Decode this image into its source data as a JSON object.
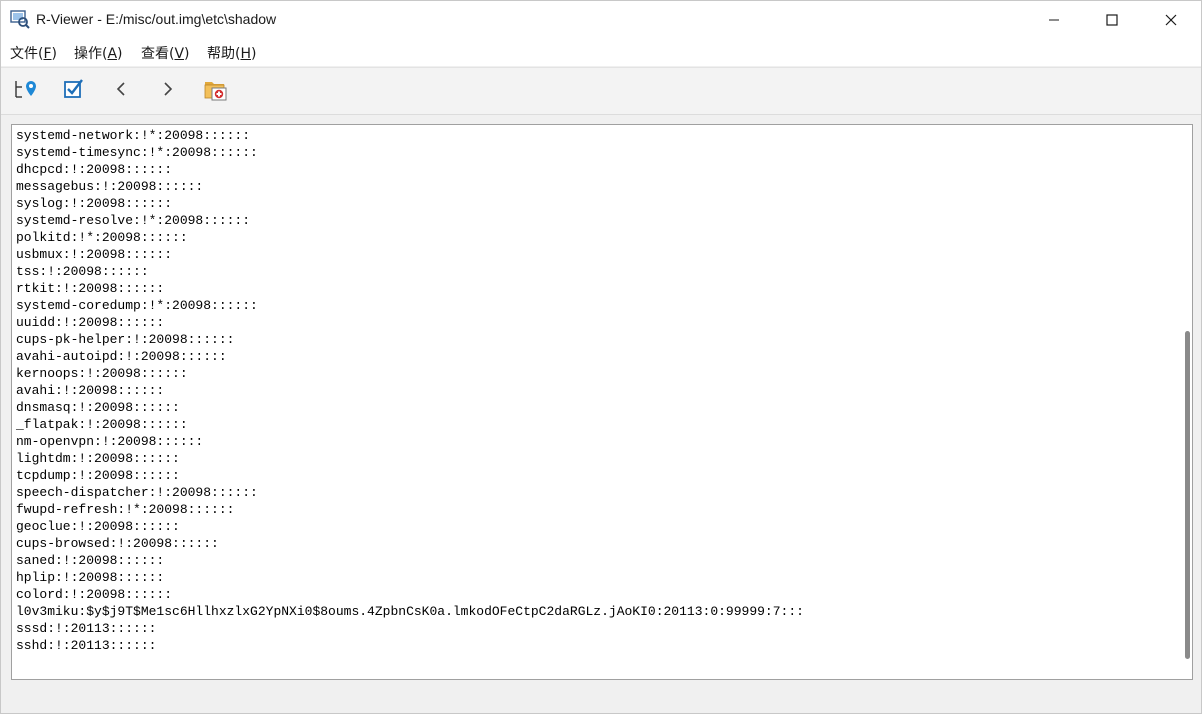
{
  "window": {
    "title": "R-Viewer - E:/misc/out.img\\etc\\shadow",
    "icons": [
      "app-icon",
      "minimize-icon",
      "maximize-icon",
      "close-icon"
    ]
  },
  "menu": {
    "items": [
      {
        "label": "文件",
        "hotkey": "F"
      },
      {
        "label": "操作",
        "hotkey": "A"
      },
      {
        "label": "查看",
        "hotkey": "V"
      },
      {
        "label": "帮助",
        "hotkey": "H"
      }
    ]
  },
  "toolbar": {
    "buttons": [
      "locate-tree-icon",
      "checkbox-icon",
      "back-arrow-icon",
      "forward-arrow-icon",
      "recover-folder-icon"
    ]
  },
  "file_lines": [
    "systemd-network:!*:20098::::::",
    "systemd-timesync:!*:20098::::::",
    "dhcpcd:!:20098::::::",
    "messagebus:!:20098::::::",
    "syslog:!:20098::::::",
    "systemd-resolve:!*:20098::::::",
    "polkitd:!*:20098::::::",
    "usbmux:!:20098::::::",
    "tss:!:20098::::::",
    "rtkit:!:20098::::::",
    "systemd-coredump:!*:20098::::::",
    "uuidd:!:20098::::::",
    "cups-pk-helper:!:20098::::::",
    "avahi-autoipd:!:20098::::::",
    "kernoops:!:20098::::::",
    "avahi:!:20098::::::",
    "dnsmasq:!:20098::::::",
    "_flatpak:!:20098::::::",
    "nm-openvpn:!:20098::::::",
    "lightdm:!:20098::::::",
    "tcpdump:!:20098::::::",
    "speech-dispatcher:!:20098::::::",
    "fwupd-refresh:!*:20098::::::",
    "geoclue:!:20098::::::",
    "cups-browsed:!:20098::::::",
    "saned:!:20098::::::",
    "hplip:!:20098::::::",
    "colord:!:20098::::::",
    "l0v3miku:$y$j9T$Me1sc6HllhxzlxG2YpNXi0$8oums.4ZpbnCsK0a.lmkodOFeCtpC2daRGLz.jAoKI0:20113:0:99999:7:::",
    "sssd:!:20113::::::",
    "sshd:!:20113::::::"
  ],
  "scrollbar": {
    "position_fraction": 0.55
  }
}
